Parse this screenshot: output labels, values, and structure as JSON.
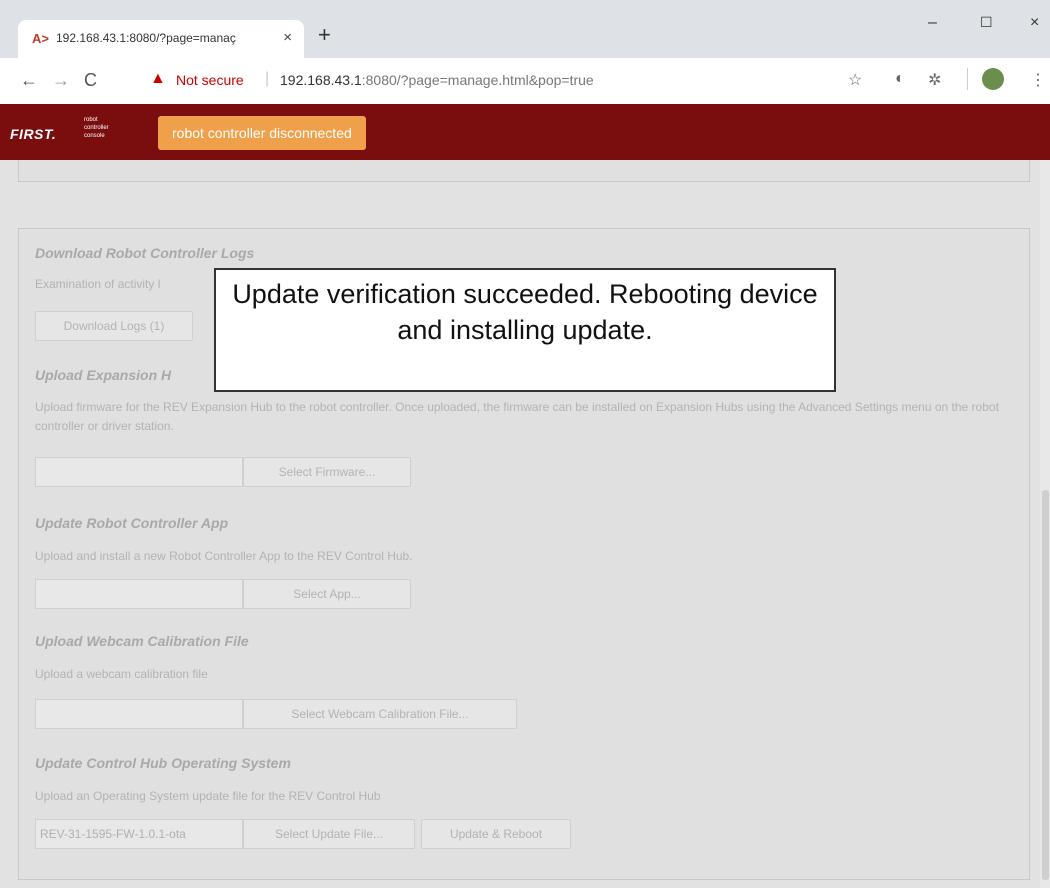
{
  "browser": {
    "tab_title": "192.168.43.1:8080/?page=manaç",
    "tab_close": "×",
    "new_tab": "+",
    "favicon": "A>",
    "window_controls": {
      "minimize": "–",
      "maximize": "☐",
      "close": "×"
    },
    "nav": {
      "back": "←",
      "forward": "→",
      "reload": "C"
    },
    "security_label": "Not secure",
    "url_host": "192.168.43.1",
    "url_rest": ":8080/?page=manage.html&pop=true",
    "icons": [
      "star-icon",
      "circle-icon",
      "extension-icon",
      "profile-icon",
      "menu-icon"
    ]
  },
  "header": {
    "brand": "FIRST.",
    "brand_sub": "robot controller console",
    "status": "robot controller disconnected",
    "colors": {
      "bar": "#7a0e0e",
      "status": "#f0a04a"
    }
  },
  "sections": {
    "logs": {
      "title": "Download Robot Controller Logs",
      "desc": "Examination of activity l",
      "button": "Download Logs (1)"
    },
    "expansion": {
      "title": "Upload Expansion H",
      "desc": "Upload firmware for the REV Expansion Hub to the robot controller. Once uploaded, the firmware can be installed on Expansion Hubs using the Advanced Settings menu on the robot controller or driver station.",
      "button": "Select Firmware..."
    },
    "app": {
      "title": "Update Robot Controller App",
      "desc": "Upload and install a new Robot Controller App to the REV Control Hub.",
      "button": "Select App..."
    },
    "webcam": {
      "title": "Upload Webcam Calibration File",
      "desc": "Upload a webcam calibration file",
      "button": "Select Webcam Calibration File..."
    },
    "os": {
      "title": "Update Control Hub Operating System",
      "desc": "Upload an Operating System update file for the REV Control Hub",
      "file_value": "REV-31-1595-FW-1.0.1-ota",
      "select_button": "Select Update File...",
      "update_button": "Update & Reboot"
    }
  },
  "modal": {
    "message": "Update verification succeeded. Rebooting device and installing update."
  }
}
